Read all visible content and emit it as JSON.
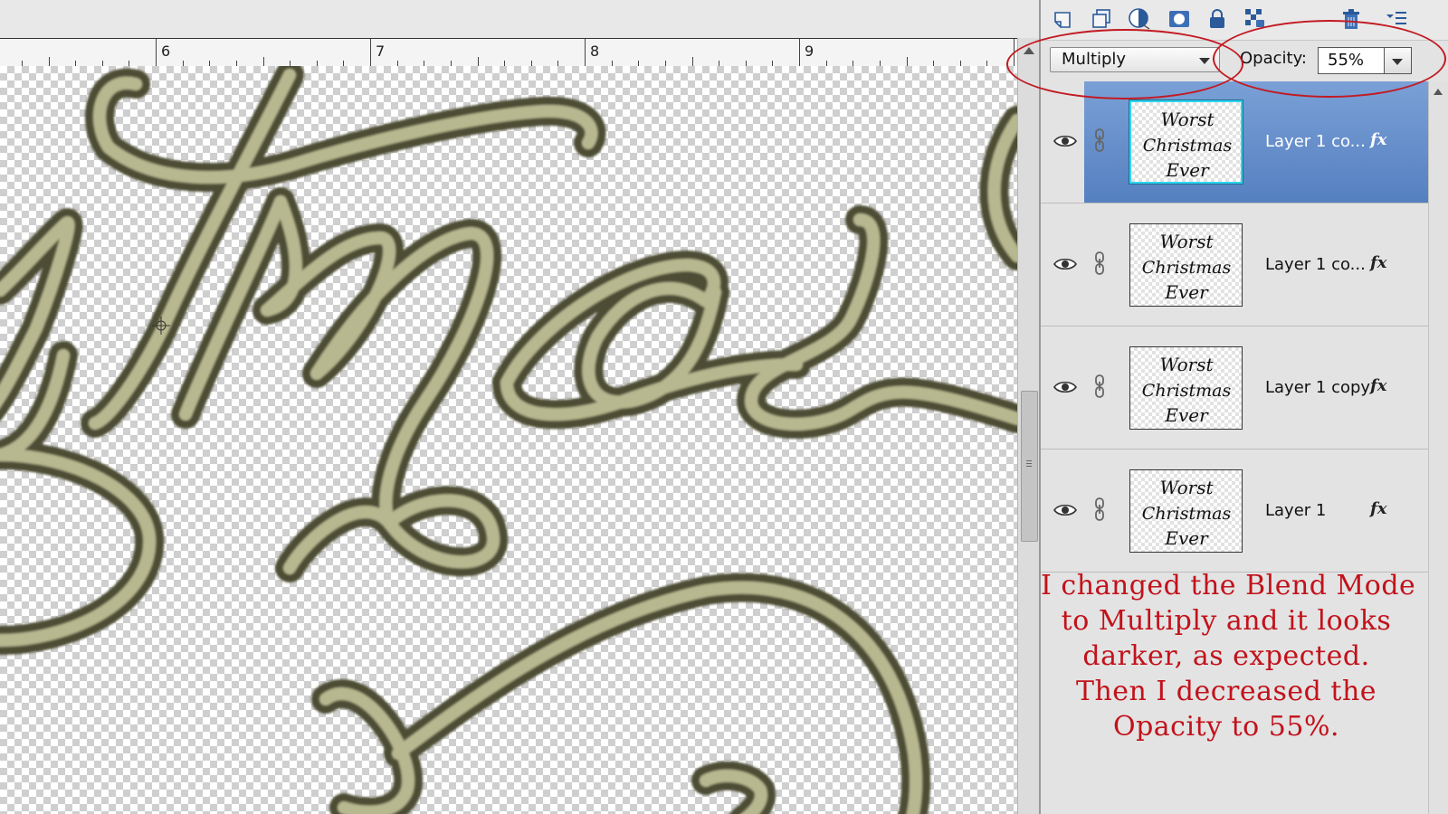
{
  "ruler": {
    "labels": [
      "6",
      "7",
      "8",
      "9"
    ]
  },
  "canvas": {
    "text": "stmas",
    "stroke_color": "#7c7c52",
    "fill_color": "#b8b890"
  },
  "toolbar": {
    "icons": [
      "new-layer-icon",
      "duplicate-layer-icon",
      "adjustment-layer-icon",
      "layer-mask-icon",
      "lock-icon",
      "lock-transparency-icon",
      "trash-icon",
      "panel-menu-icon"
    ]
  },
  "blend": {
    "mode": "Multiply"
  },
  "opacity": {
    "label": "Opacity:",
    "value": "55%"
  },
  "layers": [
    {
      "name": "Layer 1 co...",
      "selected": true,
      "fx": "fx"
    },
    {
      "name": "Layer 1 co...",
      "selected": false,
      "fx": "fx"
    },
    {
      "name": "Layer 1 copy",
      "selected": false,
      "fx": "fx"
    },
    {
      "name": "Layer 1",
      "selected": false,
      "fx": "fx"
    }
  ],
  "thumbnail_text": [
    "Worst",
    "Christmas",
    "Ever"
  ],
  "annotation": {
    "lines": [
      "I changed the Blend Mode",
      "to Multiply and it looks",
      "darker, as expected.",
      "Then I decreased the",
      "Opacity to 55%."
    ]
  },
  "colors": {
    "annotation": "#c2121b",
    "selection": "#5b86c5",
    "highlight_circle": "#c21a22"
  }
}
